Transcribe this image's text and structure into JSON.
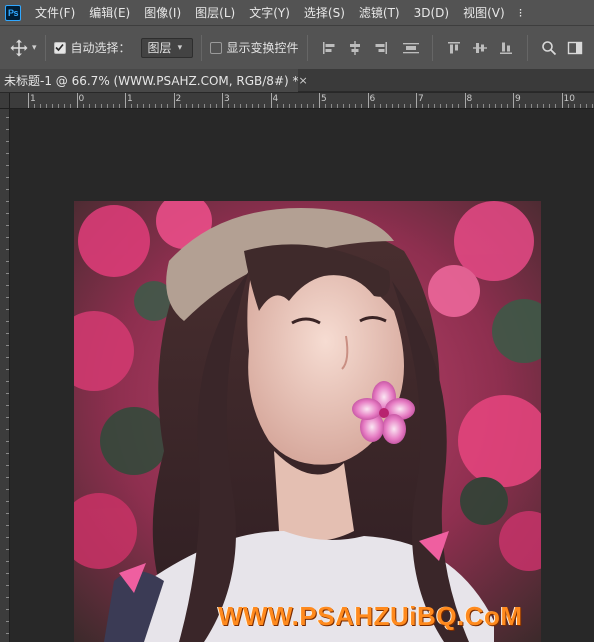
{
  "app": {
    "logo_text": "Ps",
    "menus": [
      "文件(F)",
      "编辑(E)",
      "图像(I)",
      "图层(L)",
      "文字(Y)",
      "选择(S)",
      "滤镜(T)",
      "3D(D)",
      "视图(V)"
    ],
    "menu_overflow": "⁝"
  },
  "options_bar": {
    "auto_select_label": "自动选择：",
    "auto_select_checked": true,
    "auto_select_target": "图层",
    "show_transform_label": "显示变换控件",
    "show_transform_checked": false
  },
  "document": {
    "tab_title": "未标题-1 @ 66.7% (WWW.PSAHZ.COM, RGB/8#) *",
    "close_glyph": "×"
  },
  "ruler": {
    "labels": [
      "1",
      "0",
      "1",
      "2",
      "3",
      "4",
      "5",
      "6",
      "7",
      "8",
      "9",
      "10"
    ]
  },
  "canvas": {
    "watermark": "WWW.PSAHZUiBQ.CoM"
  },
  "colors": {
    "ui_bg": "#535353",
    "workspace": "#282828",
    "accent_ps": "#31a8ff",
    "watermark": "#ff8a1e"
  }
}
